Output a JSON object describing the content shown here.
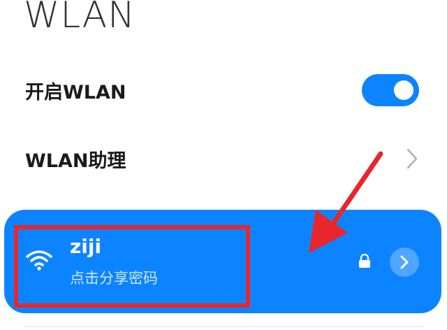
{
  "header": {
    "title": "WLAN"
  },
  "settings": {
    "enable_wlan": {
      "label": "开启WLAN",
      "enabled": true
    },
    "assistant": {
      "label": "WLAN助理"
    }
  },
  "network": {
    "ssid": "ziji",
    "subtitle": "点击分享密码",
    "secured": true
  },
  "colors": {
    "accent": "#0d84ff",
    "annotation": "#e8262b"
  },
  "icons": [
    "wifi-icon",
    "lock-icon",
    "chevron-right-icon",
    "toggle-knob"
  ]
}
